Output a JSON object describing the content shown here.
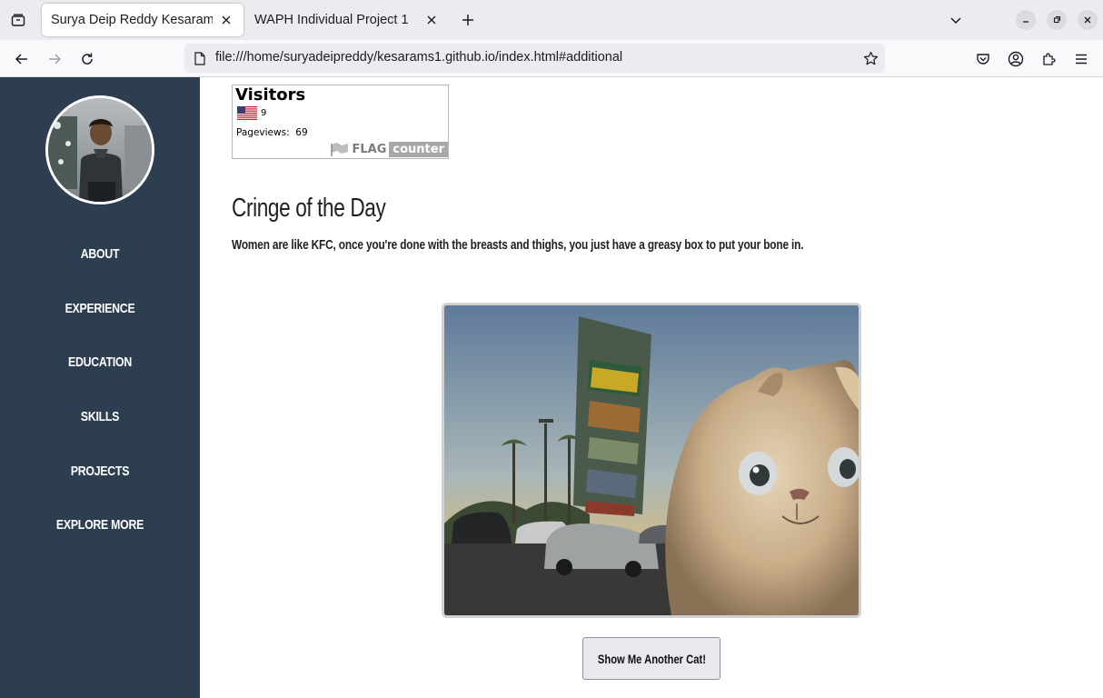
{
  "browser": {
    "tabs": [
      {
        "title": "Surya Deip Reddy Kesaram - I",
        "active": true
      },
      {
        "title": "WAPH Individual Project 1",
        "active": false
      }
    ],
    "url": "file:///home/suryadeipreddy/kesarams1.github.io/index.html#additional"
  },
  "sidebar": {
    "nav_items": [
      {
        "label": "ABOUT"
      },
      {
        "label": "EXPERIENCE"
      },
      {
        "label": "EDUCATION"
      },
      {
        "label": "SKILLS"
      },
      {
        "label": "PROJECTS"
      },
      {
        "label": "EXPLORE MORE"
      }
    ]
  },
  "flag_counter": {
    "title": "Visitors",
    "country_count": "9",
    "pageviews_label": "Pageviews:",
    "pageviews_value": "69",
    "brand_flag": "FLAG",
    "brand_counter": "counter"
  },
  "cringe": {
    "title": "Cringe of the Day",
    "text": "Women are like KFC, once you're done with the breasts and thighs, you just have a greasy box to put your bone in."
  },
  "cat": {
    "button_label": "Show Me Another Cat!"
  },
  "colors": {
    "sidebar_bg": "#2c3e50",
    "tab_bar_bg": "#ecebef"
  }
}
